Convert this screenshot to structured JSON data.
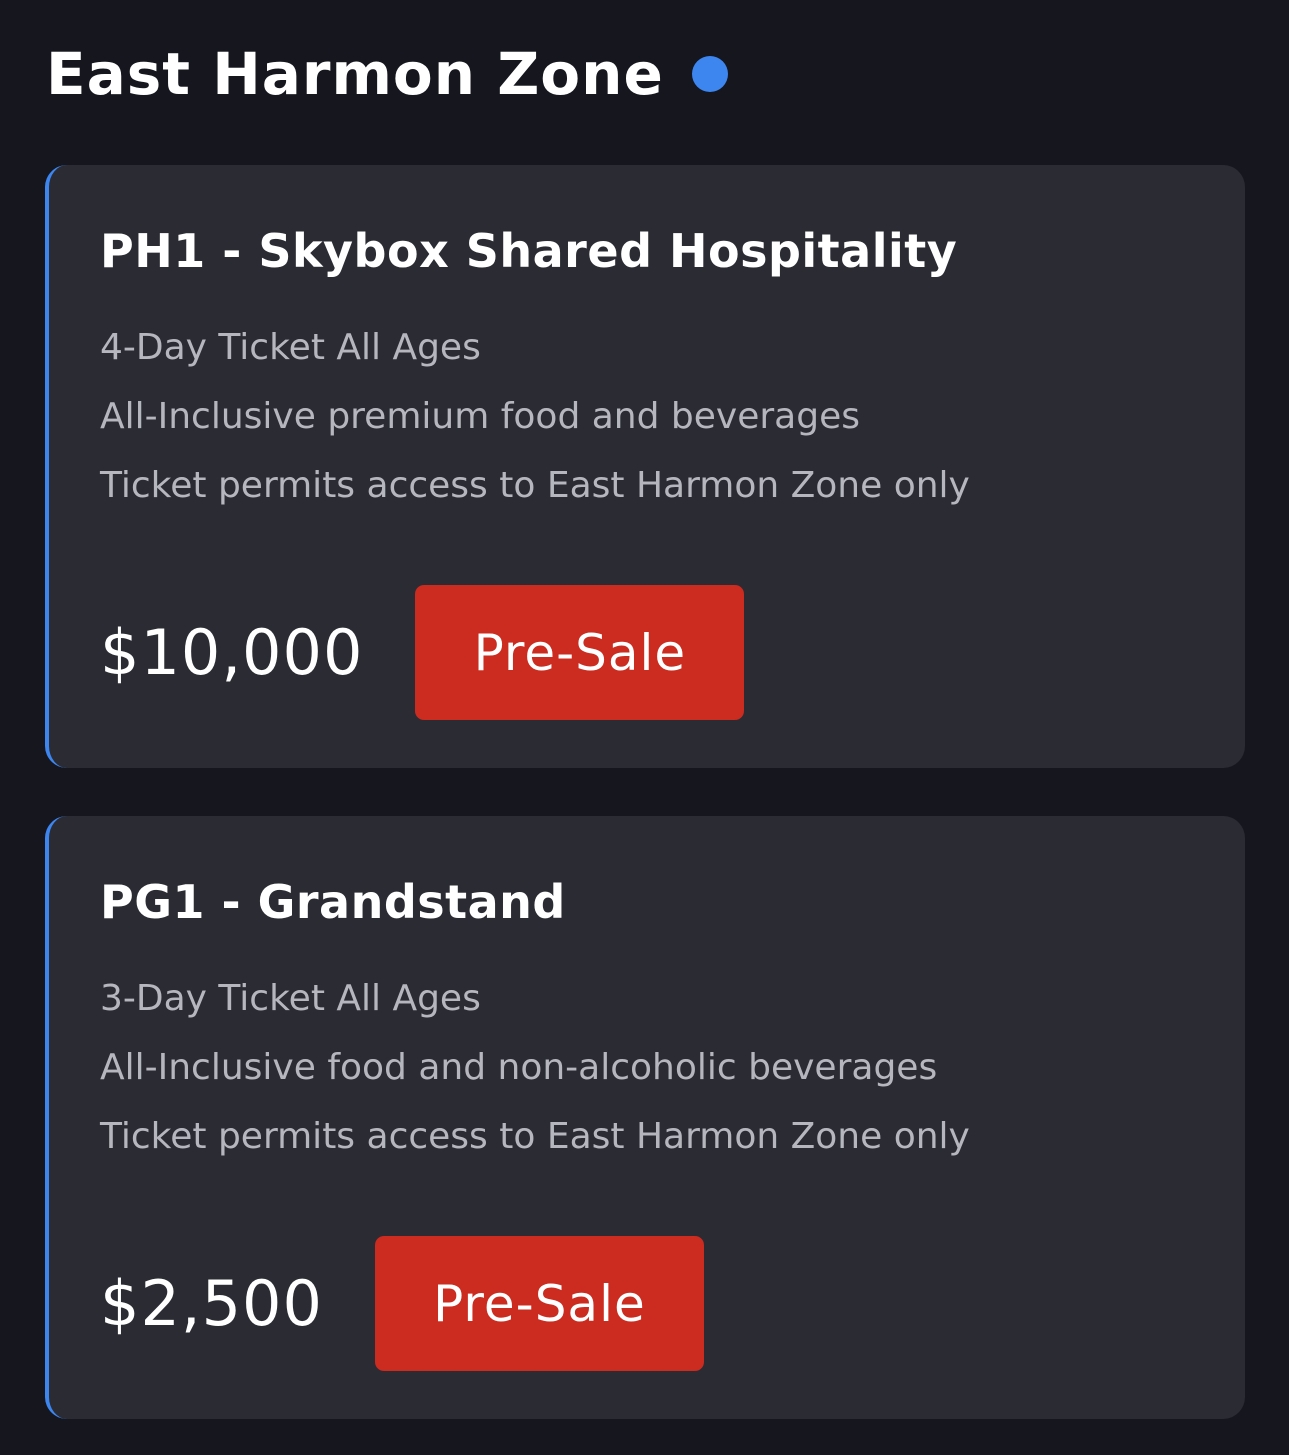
{
  "zone": {
    "title": "East Harmon Zone",
    "status_dot_color": "#3d86f0"
  },
  "accent_color": "#3d86f0",
  "button_color": "#cc2b1f",
  "tickets": [
    {
      "name": "PH1 - Skybox Shared Hospitality",
      "details": [
        "4-Day Ticket All Ages",
        "All-Inclusive premium food and beverages",
        "Ticket permits access to East Harmon Zone only"
      ],
      "price": "$10,000",
      "button_label": "Pre-Sale"
    },
    {
      "name": "PG1 - Grandstand",
      "details": [
        "3-Day Ticket All Ages",
        "All-Inclusive food and non-alcoholic beverages",
        "Ticket permits access to East Harmon Zone only"
      ],
      "price": "$2,500",
      "button_label": "Pre-Sale"
    }
  ]
}
